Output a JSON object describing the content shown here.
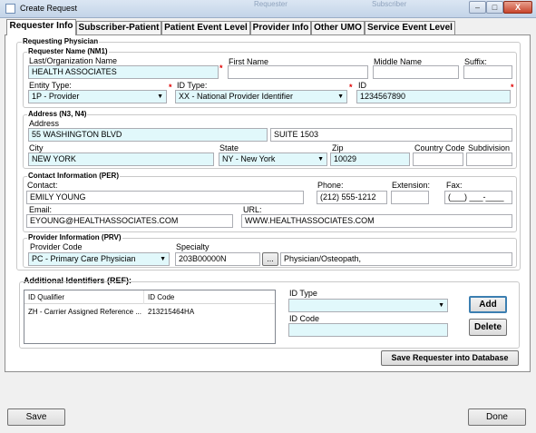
{
  "window": {
    "title": "Create Request",
    "background_tabs": [
      "Requester",
      "Subscriber"
    ],
    "controls": {
      "minimize": "–",
      "maximize": "□",
      "close": "X"
    }
  },
  "tabs": [
    "Requester Info",
    "Subscriber-Patient",
    "Patient Event Level",
    "Provider Info",
    "Other UMO",
    "Service Event Level"
  ],
  "requesting_physician": {
    "title": "Requesting Physician",
    "name_group": {
      "title": "Requester Name (NM1)",
      "last_name_label": "Last/Organization Name",
      "last_name": "HEALTH ASSOCIATES",
      "first_name_label": "First Name",
      "first_name": "",
      "middle_name_label": "Middle Name",
      "middle_name": "",
      "suffix_label": "Suffix:",
      "suffix": "",
      "entity_type_label": "Entity Type:",
      "entity_type": "1P - Provider",
      "id_type_label": "ID Type:",
      "id_type": "XX - National Provider Identifier",
      "id_label": "ID",
      "id": "1234567890"
    },
    "address_group": {
      "title": "Address (N3, N4)",
      "address_label": "Address",
      "address1": "55 WASHINGTON BLVD",
      "address2": "SUITE 1503",
      "city_label": "City",
      "city": "NEW YORK",
      "state_label": "State",
      "state": "NY - New York",
      "zip_label": "Zip",
      "zip": "10029",
      "country_label": "Country Code",
      "country": "",
      "subdivision_label": "Subdivision",
      "subdivision": ""
    },
    "contact_group": {
      "title": "Contact Information (PER)",
      "contact_label": "Contact:",
      "contact": "EMILY YOUNG",
      "phone_label": "Phone:",
      "phone": "(212) 555-1212",
      "extension_label": "Extension:",
      "extension": "",
      "fax_label": "Fax:",
      "fax": "(___) ___-____",
      "email_label": "Email:",
      "email": "EYOUNG@HEALTHASSOCIATES.COM",
      "url_label": "URL:",
      "url": "WWW.HEALTHASSOCIATES.COM"
    },
    "provider_group": {
      "title": "Provider Information (PRV)",
      "provider_code_label": "Provider Code",
      "provider_code": "PC - Primary Care Physician",
      "specialty_label": "Specialty",
      "specialty_code": "203B00000N",
      "browse_label": "...",
      "specialty_desc": "Physician/Osteopath,"
    }
  },
  "additional_identifiers": {
    "title": "Additional Identifiers (REF):",
    "columns": [
      "ID Qualifier",
      "ID Code"
    ],
    "rows": [
      {
        "qualifier": "ZH - Carrier Assigned Reference ...",
        "code": "213215464HA"
      }
    ],
    "id_type_label": "ID Type",
    "id_type": "",
    "id_code_label": "ID Code",
    "id_code": "",
    "add_label": "Add",
    "delete_label": "Delete"
  },
  "save_requester_label": "Save Requester into Database",
  "footer": {
    "save_label": "Save",
    "done_label": "Done"
  },
  "colors": {
    "required_field": "#e1f8fb",
    "required_marker": "#e00000"
  }
}
